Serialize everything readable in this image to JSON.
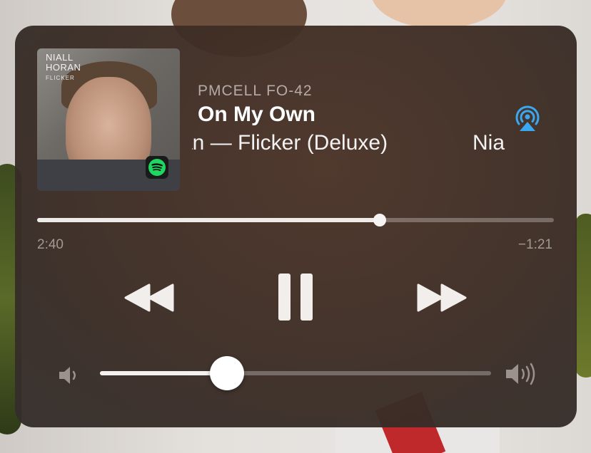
{
  "now_playing": {
    "device": "PMCELL FO-42",
    "track_title": "On My Own",
    "subtitle_fragment_1": "ran — Flicker (Deluxe)",
    "subtitle_fragment_2": "Nia",
    "artwork": {
      "title_line1": "NIALL",
      "title_line2": "HORAN",
      "subtitle": "FLICKER",
      "source_icon": "spotify-icon"
    }
  },
  "progress": {
    "elapsed": "2:40",
    "remaining": "−1:21",
    "fraction": 0.663
  },
  "volume": {
    "fraction": 0.325
  },
  "controls": {
    "rewind_icon": "rewind-icon",
    "pause_icon": "pause-icon",
    "forward_icon": "fast-forward-icon",
    "airplay_icon": "airplay-icon",
    "volume_low_icon": "speaker-low-icon",
    "volume_high_icon": "speaker-high-icon"
  },
  "colors": {
    "airplay_accent": "#3aa7f0",
    "spotify_green": "#1ed760",
    "panel_bg": "#4a3226"
  }
}
